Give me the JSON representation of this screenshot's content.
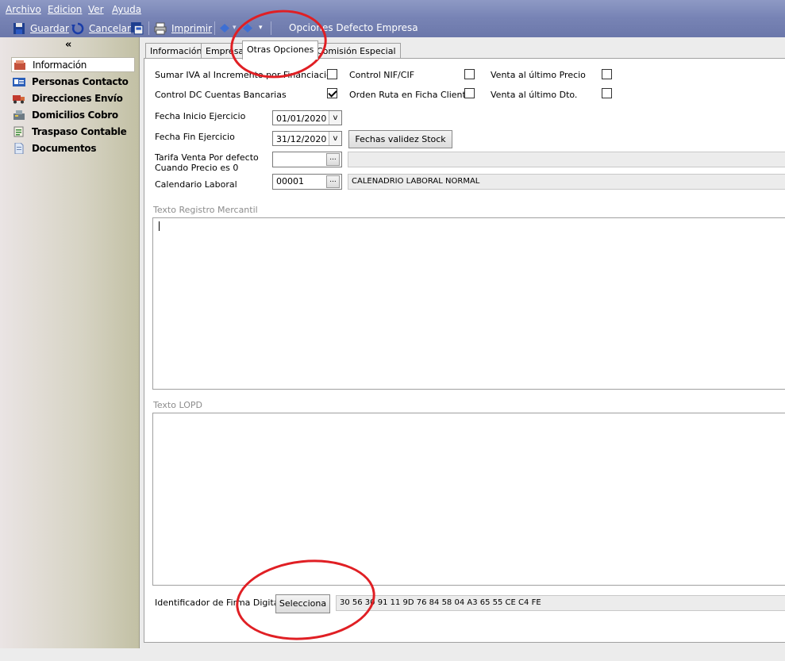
{
  "menu": {
    "archivo": "Archivo",
    "edicion": "Edicion",
    "ver": "Ver",
    "ayuda": "Ayuda"
  },
  "toolbar": {
    "guardar": "Guardar",
    "cancelar": "Cancelar",
    "imprimir": "Imprimir",
    "title": "Opciones Defecto Empresa"
  },
  "sidebar": {
    "collapse_glyph": "«",
    "items": [
      {
        "label": "Información",
        "icon": "info-icon"
      },
      {
        "label": "Personas Contacto",
        "icon": "contact-card-icon"
      },
      {
        "label": "Direcciones Envío",
        "icon": "delivery-truck-icon"
      },
      {
        "label": "Domicilios Cobro",
        "icon": "cash-register-icon"
      },
      {
        "label": "Traspaso Contable",
        "icon": "ledger-icon"
      },
      {
        "label": "Documentos",
        "icon": "document-icon"
      }
    ]
  },
  "tabs": [
    "Información",
    "Empresa",
    "Otras Opciones",
    "Comisión Especial"
  ],
  "active_tab": "Otras Opciones",
  "options": {
    "sumar_iva": {
      "label": "Sumar IVA al Incremento por Financiación",
      "checked": false
    },
    "control_nif": {
      "label": "Control NIF/CIF",
      "checked": false
    },
    "venta_ultimo_precio": {
      "label": "Venta al último Precio",
      "checked": false
    },
    "control_dc": {
      "label": "Control DC Cuentas Bancarias",
      "checked": true
    },
    "orden_ruta": {
      "label": "Orden Ruta en Ficha Cliente",
      "checked": false
    },
    "venta_ultimo_dto": {
      "label": "Venta al último Dto.",
      "checked": false
    }
  },
  "fecha_inicio": {
    "label": "Fecha Inicio Ejercicio",
    "value": "01/01/2020"
  },
  "fecha_fin": {
    "label": "Fecha Fin Ejercicio",
    "value": "31/12/2020"
  },
  "fechas_validez_button": "Fechas validez Stock",
  "tarifa": {
    "label_line1": "Tarifa Venta Por defecto",
    "label_line2": "Cuando Precio es 0",
    "value": ""
  },
  "calendario": {
    "label": "Calendario Laboral",
    "code": "00001",
    "description": "CALENADRIO LABORAL NORMAL"
  },
  "ellipsis": "...",
  "dropdown_glyph": "v",
  "texto_registro": {
    "label": "Texto Registro Mercantil",
    "value": ""
  },
  "texto_lopd": {
    "label": "Texto LOPD",
    "value": ""
  },
  "firma": {
    "label": "Identificador de Firma Digital",
    "button": "Selecciona",
    "value": "30 56 30 91 11 9D 76 84 58 04 A3 65 55 CE C4 FE"
  },
  "colors": {
    "annotation": "#e01f24",
    "titlebar": "#7783b4"
  }
}
